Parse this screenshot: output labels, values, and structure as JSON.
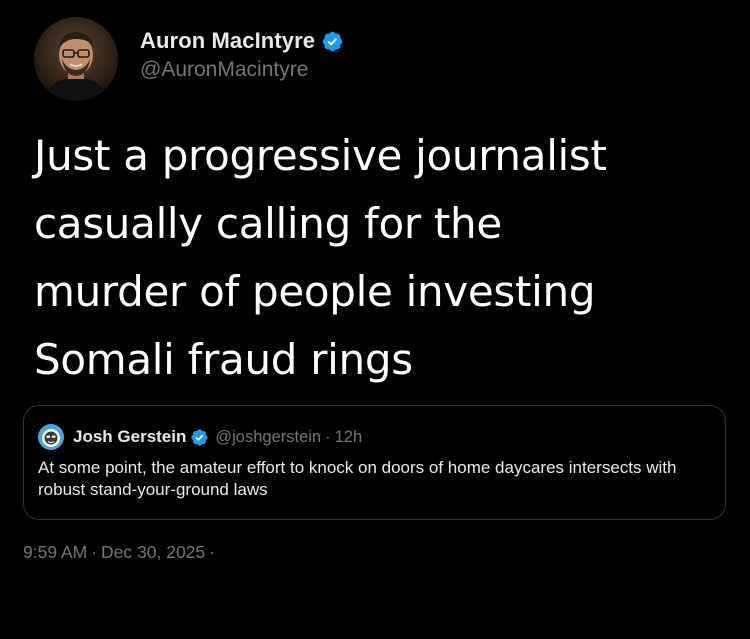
{
  "tweet": {
    "author": {
      "display_name": "Auron MacIntyre",
      "handle": "@AuronMacintyre",
      "verified": true
    },
    "text": "Just a progressive journalist\ncasually calling for the\nmurder of people investing\nSomali fraud rings",
    "quoted_tweet": {
      "author": {
        "display_name": "Josh Gerstein",
        "handle": "@joshgerstein",
        "verified": true
      },
      "separator": "·",
      "relative_time": "12h",
      "text": "At some point, the amateur effort to knock on doors of home daycares intersects with robust stand-your-ground laws"
    },
    "meta": {
      "time": "9:59 AM",
      "separator": "·",
      "date": "Dec 30, 2025",
      "trailing_separator": "·"
    }
  },
  "colors": {
    "background": "#000000",
    "primary_text": "#e7e9ea",
    "secondary_text": "#71767b",
    "verified_blue": "#1d9bf0",
    "border": "#2f3336"
  },
  "icons": {
    "verified": "verified-badge-icon",
    "avatar": "avatar",
    "quote_avatar": "quote-avatar"
  }
}
